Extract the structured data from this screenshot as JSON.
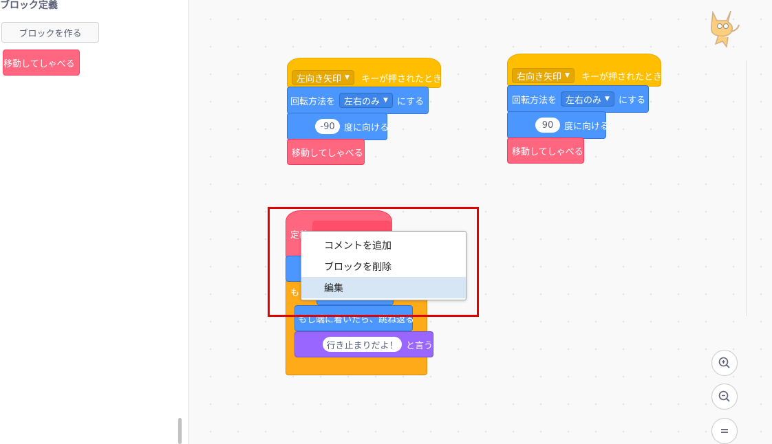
{
  "palette": {
    "title": "ブロック定義",
    "make_block_label": "ブロックを作る",
    "custom_block_label": "移動してしゃべる"
  },
  "script_left": {
    "hat_key": "左向き矢印",
    "hat_suffix": "キーが押されたとき",
    "rotation_prefix": "回転方法を",
    "rotation_value": "左右のみ",
    "rotation_suffix": "にする",
    "direction_value": "-90",
    "direction_suffix": "度に向ける",
    "custom_call": "移動してしゃべる"
  },
  "script_right": {
    "hat_key": "右向き矢印",
    "hat_suffix": "キーが押されたとき",
    "rotation_prefix": "回転方法を",
    "rotation_value": "左右のみ",
    "rotation_suffix": "にする",
    "direction_value": "90",
    "direction_suffix": "度に向ける",
    "custom_call": "移動してしゃべる"
  },
  "define_script": {
    "define_label": "定義",
    "if_label": "も",
    "bounce_label": "もし端に着いたら、跳ね返る",
    "say_value": "行き止まりだよ！",
    "say_suffix": "と言う"
  },
  "context_menu": {
    "items": [
      "コメントを追加",
      "ブロックを削除",
      "編集"
    ],
    "hovered_index": 2
  },
  "zoom": {
    "in_icon": "zoom-in-icon",
    "out_icon": "zoom-out-icon",
    "reset_icon": "zoom-reset-icon"
  },
  "colors": {
    "event": "#ffbf00",
    "motion": "#4c97ff",
    "custom": "#ff6680",
    "control": "#ffab19",
    "looks": "#9966ff",
    "highlight": "#e00000"
  }
}
